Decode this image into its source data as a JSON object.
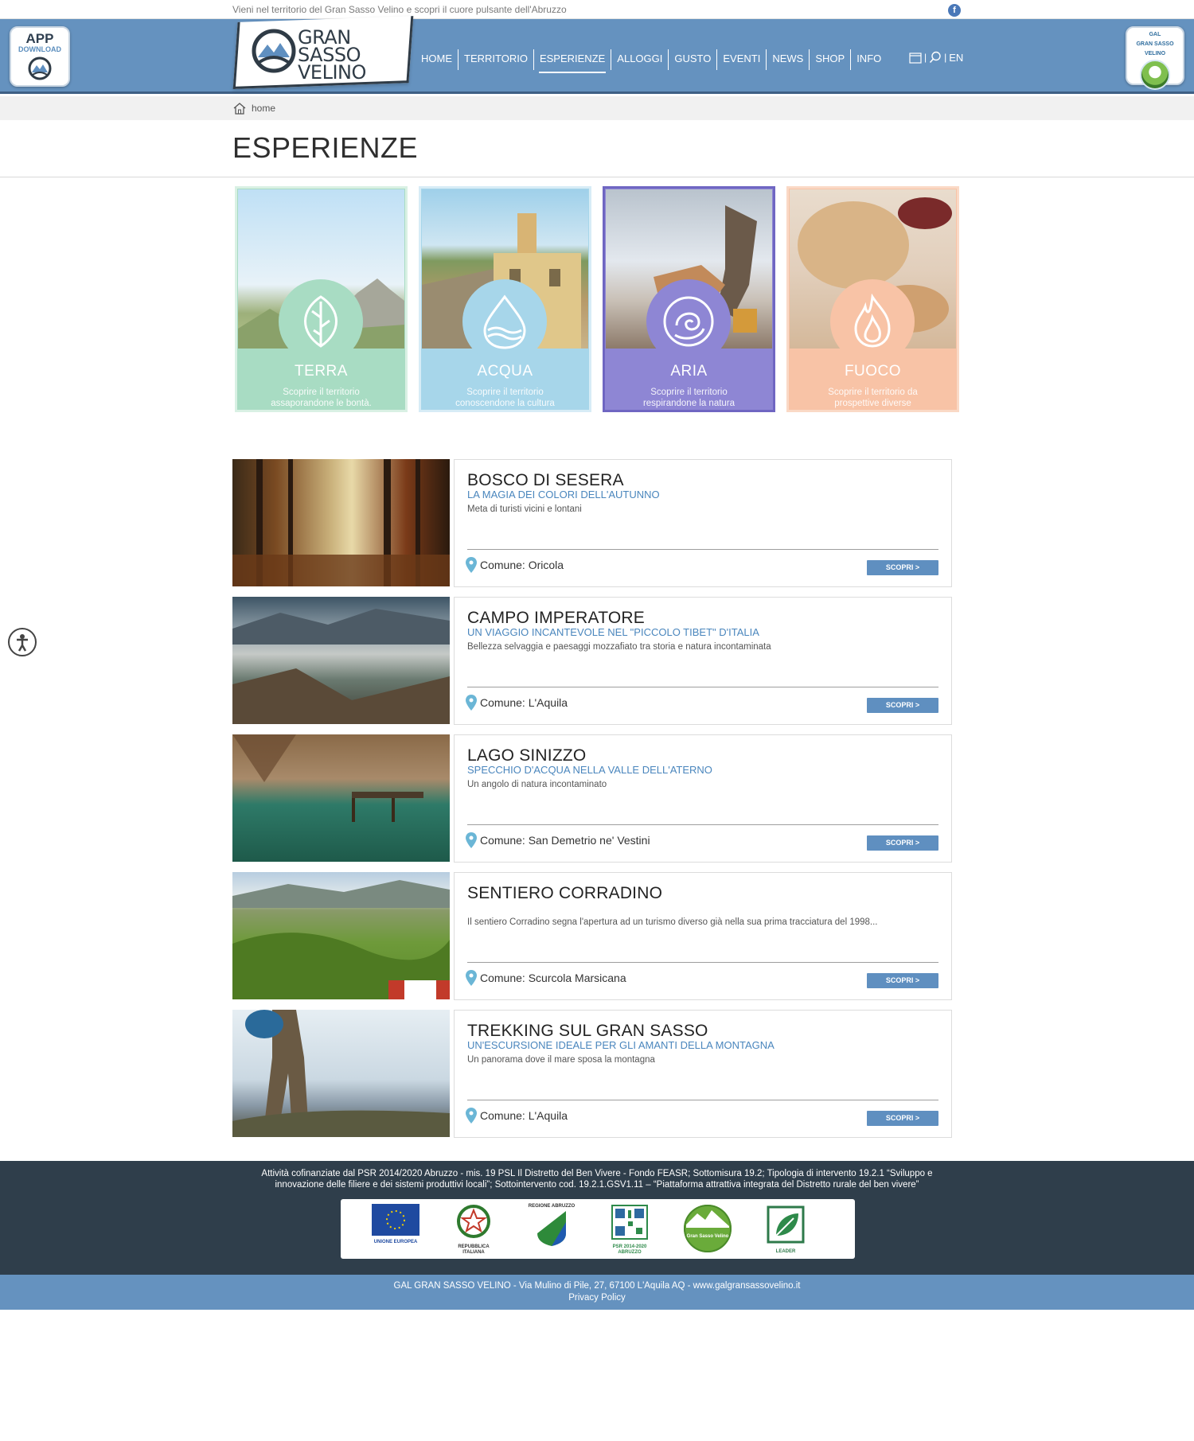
{
  "top": {
    "tagline": "Vieni nel territorio del Gran Sasso Velino e scopri il cuore pulsante dell'Abruzzo",
    "social_icon": "facebook-icon"
  },
  "header": {
    "app_badge": {
      "line1": "APP",
      "line2": "DOWNLOAD"
    },
    "logo_line1": "GRAN SASSO",
    "logo_line2": "VELINO",
    "nav": [
      "HOME",
      "TERRITORIO",
      "ESPERIENZE",
      "ALLOGGI",
      "GUSTO",
      "EVENTI",
      "NEWS",
      "SHOP",
      "INFO"
    ],
    "active_nav": "ESPERIENZE",
    "lang": "EN",
    "gal_badge": {
      "line1": "GAL",
      "line2": "GRAN SASSO",
      "line3": "VELINO"
    }
  },
  "breadcrumb": {
    "label": "home"
  },
  "page_title": "ESPERIENZE",
  "elements": [
    {
      "name": "TERRA",
      "desc1": "Scoprire il territorio",
      "desc2": "assaporandone le bontà.",
      "color": "#a8dcc3",
      "icon": "leaf-icon"
    },
    {
      "name": "ACQUA",
      "desc1": "Scoprire il territorio",
      "desc2": "conoscendone la cultura",
      "color": "#a7d6ea",
      "icon": "water-drop-icon"
    },
    {
      "name": "ARIA",
      "desc1": "Scoprire il territorio",
      "desc2": "respirandone la natura",
      "color": "#8e86d4",
      "icon": "air-swirl-icon"
    },
    {
      "name": "FUOCO",
      "desc1": "Scoprire il territorio da",
      "desc2": "prospettive diverse",
      "color": "#f8c3a6",
      "icon": "flame-icon"
    }
  ],
  "items": [
    {
      "title": "BOSCO DI SESERA",
      "subtitle": "LA MAGIA DEI COLORI DELL'AUTUNNO",
      "desc": "Meta di turisti vicini e lontani",
      "location": "Comune: Oricola",
      "button": "SCOPRI >"
    },
    {
      "title": "CAMPO IMPERATORE",
      "subtitle": "UN VIAGGIO INCANTEVOLE NEL \"PICCOLO TIBET\" D'ITALIA",
      "desc": "Bellezza selvaggia e paesaggi mozzafiato tra storia e natura incontaminata",
      "location": "Comune: L'Aquila",
      "button": "SCOPRI >"
    },
    {
      "title": "LAGO SINIZZO",
      "subtitle": "SPECCHIO D'ACQUA NELLA VALLE DELL'ATERNO",
      "desc": "Un angolo di natura incontaminato",
      "location": "Comune: San Demetrio ne' Vestini",
      "button": "SCOPRI >"
    },
    {
      "title": "SENTIERO CORRADINO",
      "subtitle": "",
      "desc": "Il sentiero Corradino segna l'apertura ad un turismo diverso già nella sua prima tracciatura del 1998...",
      "location": "Comune: Scurcola Marsicana",
      "button": "SCOPRI >"
    },
    {
      "title": "TREKKING SUL GRAN SASSO",
      "subtitle": "UN'ESCURSIONE IDEALE PER GLI AMANTI DELLA MONTAGNA",
      "desc": "Un panorama dove il mare sposa la montagna",
      "location": "Comune: L'Aquila",
      "button": "SCOPRI >"
    }
  ],
  "footer": {
    "funding_line1": "Attività cofinanziate dal PSR 2014/2020 Abruzzo - mis. 19 PSL Il Distretto del Ben Vivere - Fondo FEASR; Sottomisura 19.2; Tipologia di intervento 19.2.1 “Sviluppo e",
    "funding_line2": "innovazione delle filiere e dei sistemi produttivi locali”; Sottointervento cod. 19.2.1.GSV1.11 – “Piattaforma attrattiva integrata del Distretto rurale del ben vivere”",
    "logos": [
      {
        "caption": "UNIONE EUROPEA",
        "icon": "eu-flag-icon"
      },
      {
        "caption": "REPUBBLICA ITALIANA",
        "icon": "italian-emblem-icon"
      },
      {
        "caption": "REGIONE ABRUZZO",
        "icon": "abruzzo-shield-icon"
      },
      {
        "caption": "PSR 2014-2020 ABRUZZO",
        "icon": "qr-code-icon"
      },
      {
        "caption": "Gran Sasso Velino",
        "icon": "gal-globe-icon"
      },
      {
        "caption": "LEADER",
        "icon": "leader-icon"
      }
    ],
    "address": "GAL GRAN SASSO VELINO - Via Mulino di Pile, 27, 67100 L'Aquila AQ - www.galgransassovelino.it",
    "privacy": "Privacy Policy"
  },
  "colors": {
    "header": "#6592bf",
    "footer": "#2f3e4b",
    "accent": "#4a86bd",
    "button": "#5f8fc0"
  }
}
